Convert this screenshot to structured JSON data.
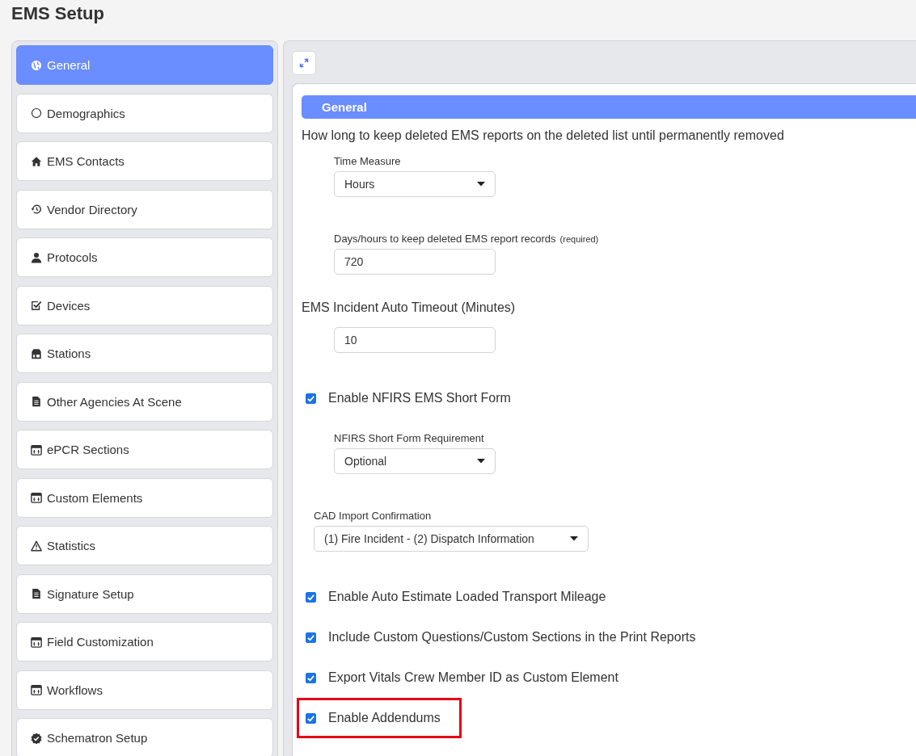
{
  "page_title": "EMS Setup",
  "sidebar": {
    "items": [
      {
        "label": "General",
        "kind": "globe",
        "selected": true
      },
      {
        "label": "Demographics",
        "kind": "circle",
        "selected": false
      },
      {
        "label": "EMS Contacts",
        "kind": "home",
        "selected": false
      },
      {
        "label": "Vendor Directory",
        "kind": "history",
        "selected": false
      },
      {
        "label": "Protocols",
        "kind": "user",
        "selected": false
      },
      {
        "label": "Devices",
        "kind": "check-square",
        "selected": false
      },
      {
        "label": "Stations",
        "kind": "store",
        "selected": false
      },
      {
        "label": "Other Agencies At Scene",
        "kind": "document",
        "selected": false
      },
      {
        "label": "ePCR Sections",
        "kind": "calendar",
        "selected": false
      },
      {
        "label": "Custom Elements",
        "kind": "calendar",
        "selected": false
      },
      {
        "label": "Statistics",
        "kind": "warning",
        "selected": false
      },
      {
        "label": "Signature Setup",
        "kind": "document",
        "selected": false
      },
      {
        "label": "Field Customization",
        "kind": "calendar",
        "selected": false
      },
      {
        "label": "Workflows",
        "kind": "calendar",
        "selected": false
      },
      {
        "label": "Schematron Setup",
        "kind": "badge",
        "selected": false
      }
    ]
  },
  "section": {
    "title": "General",
    "fields": [
      {
        "kind": "text",
        "text": "How long to keep deleted EMS reports on the deleted list until permanently removed"
      },
      {
        "kind": "select",
        "label": "Time Measure",
        "value": "Hours"
      },
      {
        "kind": "input",
        "label": "Days/hours to keep deleted EMS report records",
        "note": "(required)",
        "value": "720"
      },
      {
        "kind": "text",
        "text": "EMS Incident Auto Timeout (Minutes)"
      },
      {
        "kind": "input",
        "value": "10"
      },
      {
        "kind": "checkbox",
        "label": "Enable NFIRS EMS Short Form",
        "checked": true,
        "highlighted": false
      },
      {
        "kind": "select",
        "label": "NFIRS Short Form Requirement",
        "value": "Optional"
      },
      {
        "kind": "wide-select",
        "label": "CAD Import Confirmation",
        "value": "(1) Fire Incident - (2) Dispatch Information"
      },
      {
        "kind": "checkbox",
        "label": "Enable Auto Estimate Loaded Transport Mileage",
        "checked": true,
        "highlighted": false
      },
      {
        "kind": "checkbox",
        "label": "Include Custom Questions/Custom Sections in the Print Reports",
        "checked": true,
        "highlighted": false
      },
      {
        "kind": "checkbox",
        "label": "Export Vitals Crew Member ID as Custom Element",
        "checked": true,
        "highlighted": false
      },
      {
        "kind": "checkbox",
        "label": "Enable Addendums",
        "checked": true,
        "highlighted": true
      }
    ]
  }
}
